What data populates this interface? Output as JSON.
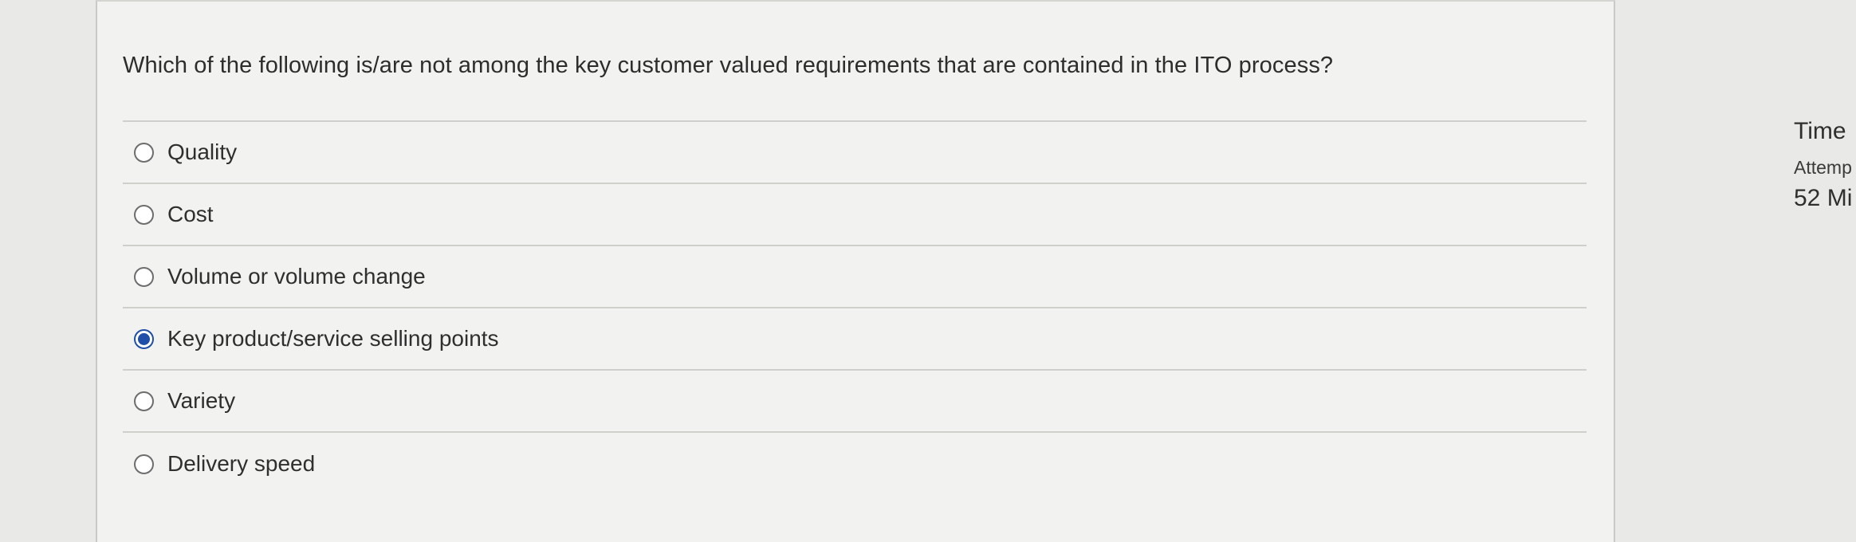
{
  "question": {
    "text": "Which of the following is/are not among the key customer valued requirements that are contained in the ITO process?",
    "options": [
      {
        "label": "Quality",
        "selected": false
      },
      {
        "label": "Cost",
        "selected": false
      },
      {
        "label": "Volume or volume change",
        "selected": false
      },
      {
        "label": "Key product/service selling points",
        "selected": true
      },
      {
        "label": "Variety",
        "selected": false
      },
      {
        "label": "Delivery speed",
        "selected": false
      }
    ]
  },
  "side_panel": {
    "title": "Time",
    "subtitle": "Attemp",
    "value": "52 Mi"
  },
  "colors": {
    "selected_radio": "#1f4fa8",
    "page_background": "#e9e9e7",
    "card_background": "#f2f2f0"
  }
}
